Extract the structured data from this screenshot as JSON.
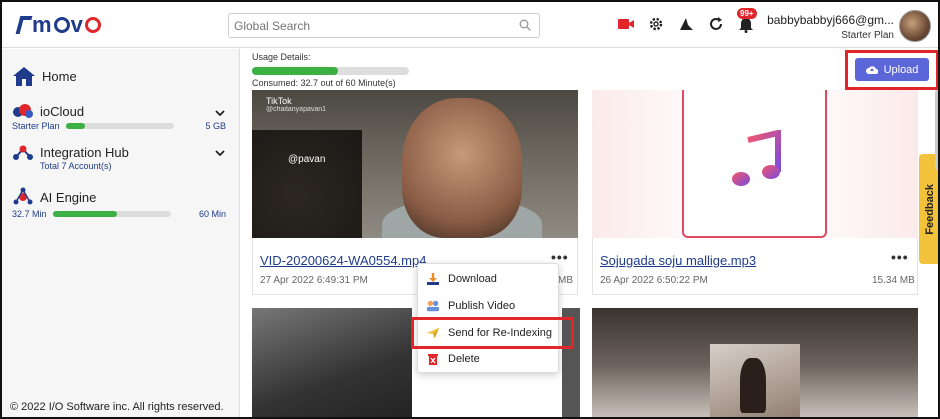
{
  "app": {
    "brand": "moVo"
  },
  "header": {
    "search_placeholder": "Global Search",
    "notification_count": "99+",
    "user_name": "babbybabbyj666@gm...",
    "user_plan": "Starter Plan"
  },
  "sidebar": {
    "home_label": "Home",
    "iocloud": {
      "title": "ioCloud",
      "plan": "Starter Plan",
      "storage": "5 GB",
      "usage_fraction": 0.18
    },
    "integration": {
      "title": "Integration Hub",
      "accounts": "Total 7 Account(s)"
    },
    "ai_engine": {
      "title": "AI Engine",
      "used": "32.7 Min",
      "total": "60 Min",
      "usage_fraction": 0.55
    }
  },
  "usage": {
    "title": "Usage Details:",
    "consumed": "Consumed: 32.7 out of 60 Minute(s)",
    "fraction": 0.545
  },
  "upload_label": "Upload",
  "cards": [
    {
      "title": "VID-20200624-WA0554.mp4",
      "date": "27 Apr 2022 6:49:31 PM",
      "size_suffix": "MB",
      "overlay_brand": "TikTok",
      "overlay_handle": "@chaitanyapavan1",
      "overlay_text": "@pavan"
    },
    {
      "title": "Sojugada soju mallige.mp3",
      "date": "26 Apr 2022 6:50:22 PM",
      "size": "15.34 MB"
    }
  ],
  "menu": {
    "download": "Download",
    "publish": "Publish Video",
    "reindex": "Send for Re-Indexing",
    "delete": "Delete"
  },
  "feedback_label": "Feedback",
  "footer": "© 2022 I/O Software inc. All rights reserved.",
  "colors": {
    "brand_blue": "#1f3b8c",
    "accent_red": "#e0262b",
    "upload_blue": "#5b67d8",
    "progress_green": "#3cb043",
    "feedback_yellow": "#f2c33a"
  }
}
